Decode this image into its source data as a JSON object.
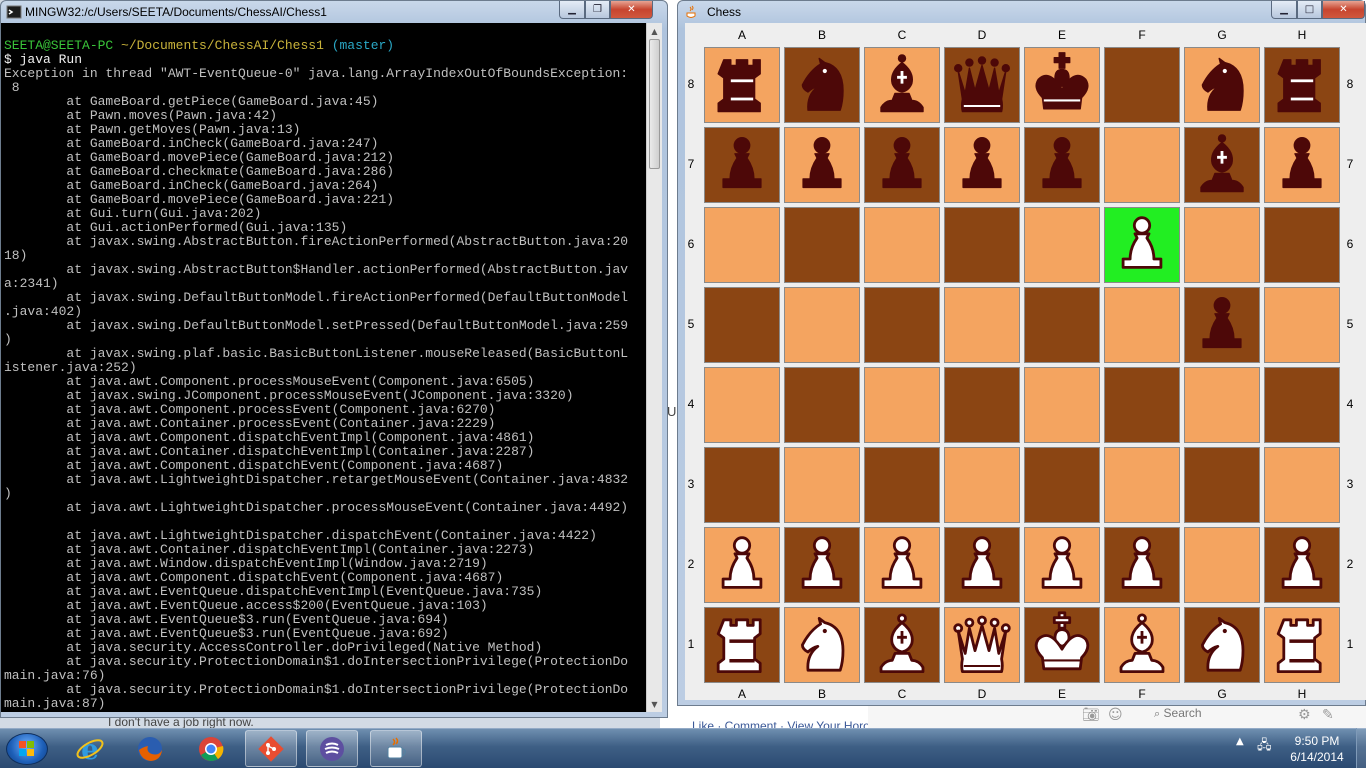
{
  "background": {
    "text_partial": "I don't have a job right now.",
    "links": "Like · Comment · View Your Horoscope",
    "search_placeholder": "Search",
    "side_letter": "U"
  },
  "terminal": {
    "title": "MINGW32:/c/Users/SEETA/Documents/ChessAI/Chess1",
    "prompt_user": "SEETA@SEETA-PC",
    "prompt_path": "~/Documents/ChessAI/Chess1",
    "prompt_branch": "(master)",
    "command": "$ java Run",
    "lines": [
      "Exception in thread \"AWT-EventQueue-0\" java.lang.ArrayIndexOutOfBoundsException:",
      " 8",
      "        at GameBoard.getPiece(GameBoard.java:45)",
      "        at Pawn.moves(Pawn.java:42)",
      "        at Pawn.getMoves(Pawn.java:13)",
      "        at GameBoard.inCheck(GameBoard.java:247)",
      "        at GameBoard.movePiece(GameBoard.java:212)",
      "        at GameBoard.checkmate(GameBoard.java:286)",
      "        at GameBoard.inCheck(GameBoard.java:264)",
      "        at GameBoard.movePiece(GameBoard.java:221)",
      "        at Gui.turn(Gui.java:202)",
      "        at Gui.actionPerformed(Gui.java:135)",
      "        at javax.swing.AbstractButton.fireActionPerformed(AbstractButton.java:20",
      "18)",
      "        at javax.swing.AbstractButton$Handler.actionPerformed(AbstractButton.jav",
      "a:2341)",
      "        at javax.swing.DefaultButtonModel.fireActionPerformed(DefaultButtonModel",
      ".java:402)",
      "        at javax.swing.DefaultButtonModel.setPressed(DefaultButtonModel.java:259",
      ")",
      "        at javax.swing.plaf.basic.BasicButtonListener.mouseReleased(BasicButtonL",
      "istener.java:252)",
      "        at java.awt.Component.processMouseEvent(Component.java:6505)",
      "        at javax.swing.JComponent.processMouseEvent(JComponent.java:3320)",
      "        at java.awt.Component.processEvent(Component.java:6270)",
      "        at java.awt.Container.processEvent(Container.java:2229)",
      "        at java.awt.Component.dispatchEventImpl(Component.java:4861)",
      "        at java.awt.Container.dispatchEventImpl(Container.java:2287)",
      "        at java.awt.Component.dispatchEvent(Component.java:4687)",
      "        at java.awt.LightweightDispatcher.retargetMouseEvent(Container.java:4832",
      ")",
      "        at java.awt.LightweightDispatcher.processMouseEvent(Container.java:4492)",
      "",
      "        at java.awt.LightweightDispatcher.dispatchEvent(Container.java:4422)",
      "        at java.awt.Container.dispatchEventImpl(Container.java:2273)",
      "        at java.awt.Window.dispatchEventImpl(Window.java:2719)",
      "        at java.awt.Component.dispatchEvent(Component.java:4687)",
      "        at java.awt.EventQueue.dispatchEventImpl(EventQueue.java:735)",
      "        at java.awt.EventQueue.access$200(EventQueue.java:103)",
      "        at java.awt.EventQueue$3.run(EventQueue.java:694)",
      "        at java.awt.EventQueue$3.run(EventQueue.java:692)",
      "        at java.security.AccessController.doPrivileged(Native Method)",
      "        at java.security.ProtectionDomain$1.doIntersectionPrivilege(ProtectionDo",
      "main.java:76)",
      "        at java.security.ProtectionDomain$1.doIntersectionPrivilege(ProtectionDo",
      "main.java:87)"
    ]
  },
  "chess": {
    "title": "Chess",
    "files": [
      "A",
      "B",
      "C",
      "D",
      "E",
      "F",
      "G",
      "H"
    ],
    "ranks": [
      "8",
      "7",
      "6",
      "5",
      "4",
      "3",
      "2",
      "1"
    ],
    "colors": {
      "light": "#f4a460",
      "dark": "#8b4513",
      "highlight": "#22ee22",
      "black_piece": "#4d0808",
      "white_piece": "#ffffff"
    },
    "board": [
      [
        "br",
        "bn",
        "bb",
        "bq",
        "bk",
        "",
        "bn",
        "br"
      ],
      [
        "bp",
        "bp",
        "bp",
        "bp",
        "bp",
        "",
        "bb",
        "bp"
      ],
      [
        "",
        "",
        "",
        "",
        "",
        "wp",
        "",
        ""
      ],
      [
        "",
        "",
        "",
        "",
        "",
        "",
        "bp",
        ""
      ],
      [
        "",
        "",
        "",
        "",
        "",
        "",
        "",
        ""
      ],
      [
        "",
        "",
        "",
        "",
        "",
        "",
        "",
        ""
      ],
      [
        "wp",
        "wp",
        "wp",
        "wp",
        "wp",
        "wp",
        "",
        "wp"
      ],
      [
        "wr",
        "wn",
        "wb",
        "wq",
        "wk",
        "wb",
        "wn",
        "wr"
      ]
    ],
    "highlight": {
      "row": 2,
      "col": 5
    }
  },
  "taskbar": {
    "time": "9:50 PM",
    "date": "6/14/2014",
    "apps": [
      "internet-explorer",
      "firefox",
      "chrome",
      "git",
      "eclipse",
      "java"
    ]
  }
}
